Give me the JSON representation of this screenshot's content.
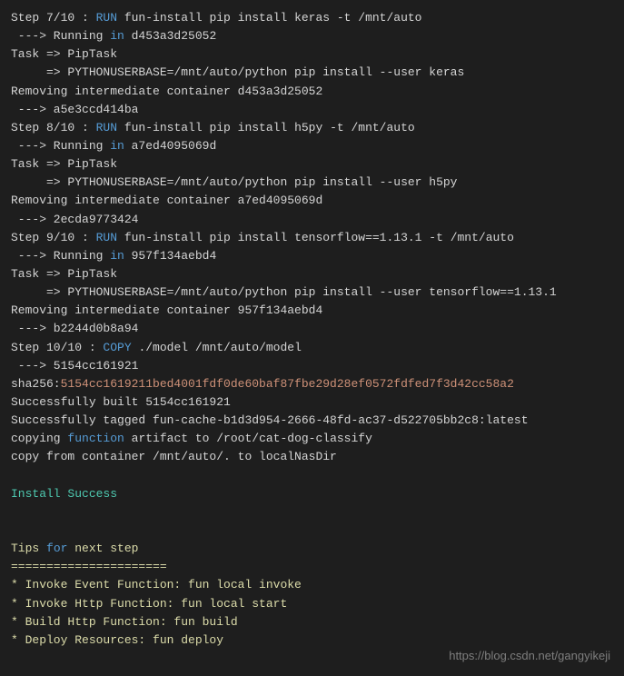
{
  "lines": [
    {
      "segments": [
        {
          "text": "Step 7/10 : ",
          "class": "white"
        },
        {
          "text": "RUN",
          "class": "keyword"
        },
        {
          "text": " fun-install pip install keras -t /mnt/auto",
          "class": "white"
        }
      ]
    },
    {
      "segments": [
        {
          "text": " ---> Running ",
          "class": "white"
        },
        {
          "text": "in",
          "class": "keyword"
        },
        {
          "text": " d453a3d25052",
          "class": "white"
        }
      ]
    },
    {
      "segments": [
        {
          "text": "Task => PipTask",
          "class": "white"
        }
      ]
    },
    {
      "segments": [
        {
          "text": "     => PYTHONUSERBASE=/mnt/auto/python pip install --user keras",
          "class": "white"
        }
      ]
    },
    {
      "segments": [
        {
          "text": "Removing intermediate container d453a3d25052",
          "class": "white"
        }
      ]
    },
    {
      "segments": [
        {
          "text": " ---> a5e3ccd414ba",
          "class": "white"
        }
      ]
    },
    {
      "segments": [
        {
          "text": "Step 8/10 : ",
          "class": "white"
        },
        {
          "text": "RUN",
          "class": "keyword"
        },
        {
          "text": " fun-install pip install h5py -t /mnt/auto",
          "class": "white"
        }
      ]
    },
    {
      "segments": [
        {
          "text": " ---> Running ",
          "class": "white"
        },
        {
          "text": "in",
          "class": "keyword"
        },
        {
          "text": " a7ed4095069d",
          "class": "white"
        }
      ]
    },
    {
      "segments": [
        {
          "text": "Task => PipTask",
          "class": "white"
        }
      ]
    },
    {
      "segments": [
        {
          "text": "     => PYTHONUSERBASE=/mnt/auto/python pip install --user h5py",
          "class": "white"
        }
      ]
    },
    {
      "segments": [
        {
          "text": "Removing intermediate container a7ed4095069d",
          "class": "white"
        }
      ]
    },
    {
      "segments": [
        {
          "text": " ---> 2ecda9773424",
          "class": "white"
        }
      ]
    },
    {
      "segments": [
        {
          "text": "Step 9/10 : ",
          "class": "white"
        },
        {
          "text": "RUN",
          "class": "keyword"
        },
        {
          "text": " fun-install pip install tensorflow==1.13.1 -t /mnt/auto",
          "class": "white"
        }
      ]
    },
    {
      "segments": [
        {
          "text": " ---> Running ",
          "class": "white"
        },
        {
          "text": "in",
          "class": "keyword"
        },
        {
          "text": " 957f134aebd4",
          "class": "white"
        }
      ]
    },
    {
      "segments": [
        {
          "text": "Task => PipTask",
          "class": "white"
        }
      ]
    },
    {
      "segments": [
        {
          "text": "     => PYTHONUSERBASE=/mnt/auto/python pip install --user tensorflow==1.13.1",
          "class": "white"
        }
      ]
    },
    {
      "segments": [
        {
          "text": "Removing intermediate container 957f134aebd4",
          "class": "white"
        }
      ]
    },
    {
      "segments": [
        {
          "text": " ---> b2244d0b8a94",
          "class": "white"
        }
      ]
    },
    {
      "segments": [
        {
          "text": "Step 10/10 : ",
          "class": "white"
        },
        {
          "text": "COPY",
          "class": "keyword"
        },
        {
          "text": " ./model /mnt/auto/model",
          "class": "white"
        }
      ]
    },
    {
      "segments": [
        {
          "text": " ---> 5154cc161921",
          "class": "white"
        }
      ]
    },
    {
      "segments": [
        {
          "text": "sha256:",
          "class": "white"
        },
        {
          "text": "5154cc1619211bed4001fdf0de60baf87fbe29d28ef0572fdfed7f3d42cc58a2",
          "class": "string"
        }
      ]
    },
    {
      "segments": [
        {
          "text": "Successfully built 5154cc161921",
          "class": "white"
        }
      ]
    },
    {
      "segments": [
        {
          "text": "Successfully tagged fun-cache-b1d3d954-2666-48fd-ac37-d522705bb2c8:latest",
          "class": "white"
        }
      ]
    },
    {
      "segments": [
        {
          "text": "copying ",
          "class": "white"
        },
        {
          "text": "function",
          "class": "keyword"
        },
        {
          "text": " artifact to /root/cat-dog-classify",
          "class": "white"
        }
      ]
    },
    {
      "segments": [
        {
          "text": "copy from container /mnt/auto/. to localNasDir",
          "class": "white"
        }
      ]
    },
    {
      "segments": [
        {
          "text": " ",
          "class": "white"
        }
      ]
    },
    {
      "segments": [
        {
          "text": "Install Success",
          "class": "green"
        }
      ]
    },
    {
      "segments": [
        {
          "text": " ",
          "class": "white"
        }
      ]
    },
    {
      "segments": [
        {
          "text": " ",
          "class": "white"
        }
      ]
    },
    {
      "segments": [
        {
          "text": "Tips ",
          "class": "yellow"
        },
        {
          "text": "for",
          "class": "keyword"
        },
        {
          "text": " next step",
          "class": "yellow"
        }
      ]
    },
    {
      "segments": [
        {
          "text": "======================",
          "class": "yellow"
        }
      ]
    },
    {
      "segments": [
        {
          "text": "* Invoke Event Function: fun local invoke",
          "class": "yellow"
        }
      ]
    },
    {
      "segments": [
        {
          "text": "* Invoke Http Function: fun local start",
          "class": "yellow"
        }
      ]
    },
    {
      "segments": [
        {
          "text": "* Build Http Function: fun build",
          "class": "yellow"
        }
      ]
    },
    {
      "segments": [
        {
          "text": "* Deploy Resources: fun deploy",
          "class": "yellow"
        }
      ]
    }
  ],
  "watermark": "https://blog.csdn.net/gangyikeji"
}
